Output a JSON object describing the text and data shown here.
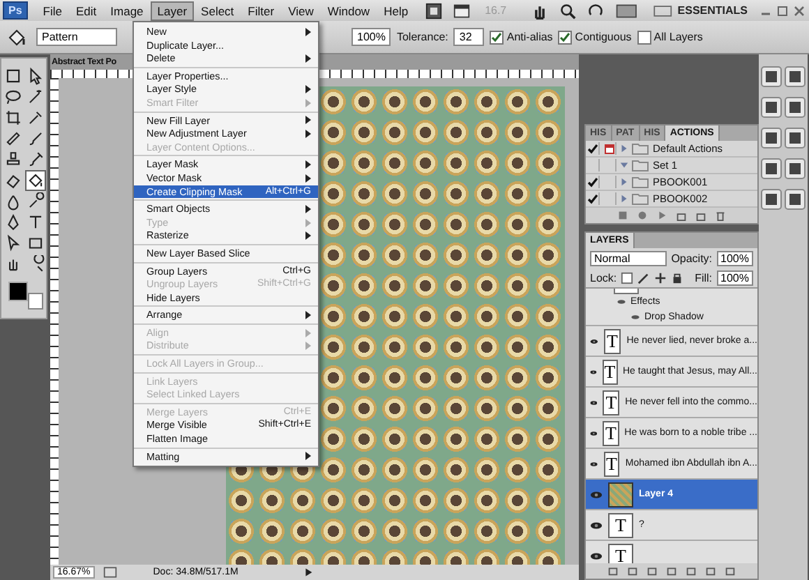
{
  "menubar": {
    "logo": "Ps",
    "items": [
      {
        "label": "File",
        "selected": false
      },
      {
        "label": "Edit",
        "selected": false
      },
      {
        "label": "Image",
        "selected": false
      },
      {
        "label": "Layer",
        "selected": true
      },
      {
        "label": "Select",
        "selected": false
      },
      {
        "label": "Filter",
        "selected": false
      },
      {
        "label": "View",
        "selected": false
      },
      {
        "label": "Window",
        "selected": false
      },
      {
        "label": "Help",
        "selected": false
      }
    ],
    "zoom": "16.7",
    "workspace": "ESSENTIALS"
  },
  "options": {
    "preset": "Pattern",
    "opacity": "100%",
    "tolerance_label": "Tolerance:",
    "tolerance": "32",
    "checks": [
      {
        "label": "Anti-alias",
        "checked": true
      },
      {
        "label": "Contiguous",
        "checked": true
      },
      {
        "label": "All Layers",
        "checked": false
      }
    ]
  },
  "tools": [
    {
      "selected": false
    },
    {
      "selected": false
    },
    {
      "selected": false
    },
    {
      "selected": false
    },
    {
      "selected": false
    },
    {
      "selected": false
    },
    {
      "selected": false
    },
    {
      "selected": false
    },
    {
      "selected": false
    },
    {
      "selected": false
    },
    {
      "selected": false
    },
    {
      "selected": true
    },
    {
      "selected": false
    },
    {
      "selected": false
    },
    {
      "selected": false
    },
    {
      "selected": false
    },
    {
      "selected": false
    },
    {
      "selected": false
    },
    {
      "selected": false
    },
    {
      "selected": false
    }
  ],
  "document": {
    "title": "Abstract Text Po",
    "zoom": "16.67%",
    "doc_info": "Doc: 34.8M/517.1M"
  },
  "layer_menu": {
    "groups": [
      [
        {
          "label": "New",
          "submenu": true,
          "disabled": false,
          "selected": false
        },
        {
          "label": "Duplicate Layer...",
          "disabled": false,
          "selected": false
        },
        {
          "label": "Delete",
          "submenu": true,
          "disabled": false,
          "selected": false
        }
      ],
      [
        {
          "label": "Layer Properties...",
          "disabled": false,
          "selected": false
        },
        {
          "label": "Layer Style",
          "submenu": true,
          "disabled": false,
          "selected": false
        },
        {
          "label": "Smart Filter",
          "submenu": true,
          "disabled": true,
          "selected": false
        }
      ],
      [
        {
          "label": "New Fill Layer",
          "submenu": true,
          "disabled": false,
          "selected": false
        },
        {
          "label": "New Adjustment Layer",
          "submenu": true,
          "disabled": false,
          "selected": false
        },
        {
          "label": "Layer Content Options...",
          "disabled": true,
          "selected": false
        }
      ],
      [
        {
          "label": "Layer Mask",
          "submenu": true,
          "disabled": false,
          "selected": false
        },
        {
          "label": "Vector Mask",
          "submenu": true,
          "disabled": false,
          "selected": false
        },
        {
          "label": "Create Clipping Mask",
          "shortcut": "Alt+Ctrl+G",
          "disabled": false,
          "selected": true
        }
      ],
      [
        {
          "label": "Smart Objects",
          "submenu": true,
          "disabled": false,
          "selected": false
        },
        {
          "label": "Type",
          "submenu": true,
          "disabled": true,
          "selected": false
        },
        {
          "label": "Rasterize",
          "submenu": true,
          "disabled": false,
          "selected": false
        }
      ],
      [
        {
          "label": "New Layer Based Slice",
          "disabled": false,
          "selected": false
        }
      ],
      [
        {
          "label": "Group Layers",
          "shortcut": "Ctrl+G",
          "disabled": false,
          "selected": false
        },
        {
          "label": "Ungroup Layers",
          "shortcut": "Shift+Ctrl+G",
          "disabled": true,
          "selected": false
        },
        {
          "label": "Hide Layers",
          "disabled": false,
          "selected": false
        }
      ],
      [
        {
          "label": "Arrange",
          "submenu": true,
          "disabled": false,
          "selected": false
        }
      ],
      [
        {
          "label": "Align",
          "submenu": true,
          "disabled": true,
          "selected": false
        },
        {
          "label": "Distribute",
          "submenu": true,
          "disabled": true,
          "selected": false
        }
      ],
      [
        {
          "label": "Lock All Layers in Group...",
          "disabled": true,
          "selected": false
        }
      ],
      [
        {
          "label": "Link Layers",
          "disabled": true,
          "selected": false
        },
        {
          "label": "Select Linked Layers",
          "disabled": true,
          "selected": false
        }
      ],
      [
        {
          "label": "Merge Layers",
          "shortcut": "Ctrl+E",
          "disabled": true,
          "selected": false
        },
        {
          "label": "Merge Visible",
          "shortcut": "Shift+Ctrl+E",
          "disabled": false,
          "selected": false
        },
        {
          "label": "Flatten Image",
          "disabled": false,
          "selected": false
        }
      ],
      [
        {
          "label": "Matting",
          "submenu": true,
          "disabled": false,
          "selected": false
        }
      ]
    ]
  },
  "actions_panel": {
    "tabs": [
      {
        "label": "HIS",
        "selected": false
      },
      {
        "label": "PAT",
        "selected": false
      },
      {
        "label": "HIS",
        "selected": false
      },
      {
        "label": "ACTIONS",
        "selected": true
      }
    ],
    "rows": [
      {
        "label": "Default Actions",
        "checked": true,
        "dialog": true,
        "expanded": false
      },
      {
        "label": "Set 1",
        "checked": false,
        "dialog": false,
        "expanded": true
      },
      {
        "label": "PBOOK001",
        "checked": true,
        "dialog": false,
        "expanded": false
      },
      {
        "label": "PBOOK002",
        "checked": true,
        "dialog": false,
        "expanded": false
      }
    ]
  },
  "layers_panel": {
    "tab": "LAYERS",
    "blend_mode": "Normal",
    "opacity_label": "Opacity:",
    "opacity": "100%",
    "lock_label": "Lock:",
    "fill_label": "Fill:",
    "fill": "100%",
    "layers": [
      {
        "kind": "effects",
        "name": "Effects"
      },
      {
        "kind": "effect",
        "name": "Drop Shadow"
      },
      {
        "kind": "text",
        "thumb": "T",
        "name": "He never lied, never broke a...",
        "visible": true,
        "selected": false
      },
      {
        "kind": "text",
        "thumb": "T",
        "name": "He taught that Jesus, may All...",
        "visible": true,
        "selected": false
      },
      {
        "kind": "text",
        "thumb": "T",
        "name": "He never fell into the commo...",
        "visible": true,
        "selected": false
      },
      {
        "kind": "text",
        "thumb": "T",
        "name": "He was born to a noble tribe ...",
        "visible": true,
        "selected": false
      },
      {
        "kind": "text",
        "thumb": "T",
        "name": "Mohamed ibn Abdullah ibn A...",
        "visible": true,
        "selected": false
      },
      {
        "kind": "image",
        "name": "Layer 4",
        "visible": true,
        "selected": true
      },
      {
        "kind": "text",
        "thumb": "T",
        "name": "?",
        "visible": true,
        "selected": false
      },
      {
        "kind": "text",
        "thumb": "T",
        "visible": true,
        "selected": false
      }
    ]
  }
}
